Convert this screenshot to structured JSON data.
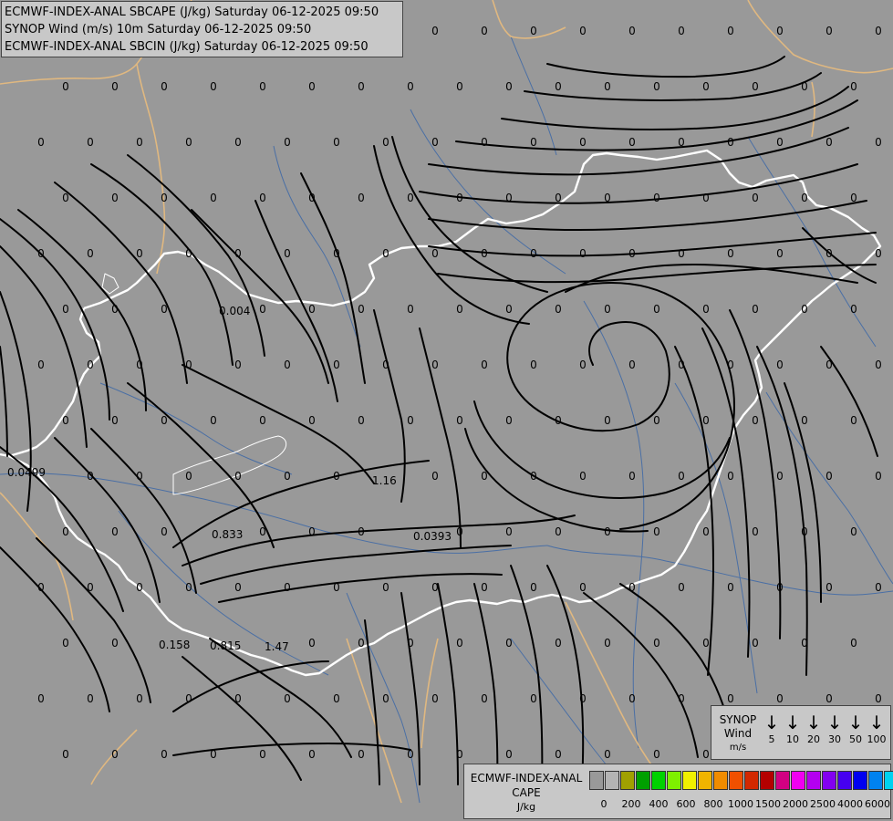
{
  "header": {
    "line1": "ECMWF-INDEX-ANAL SBCAPE (J/kg) Saturday 06-12-2025 09:50",
    "line2": "SYNOP Wind (m/s) 10m Saturday 06-12-2025 09:50",
    "line3": "ECMWF-INDEX-ANAL SBCIN (J/kg) Saturday 06-12-2025 09:50"
  },
  "map_colors": {
    "background": "#999999",
    "border_country": "#ffffff",
    "border_neighbor": "#e0b880",
    "river": "#4a6fa5",
    "streamline": "#000000",
    "value_text": "#000000"
  },
  "nonzero_values": [
    "0.004",
    "0.0499",
    "1.16",
    "0.833",
    "0.0393",
    "0.158",
    "0.815",
    "1.47"
  ],
  "wind_legend": {
    "label_line1": "SYNOP",
    "label_line2": "Wind",
    "unit": "m/s",
    "arrow_icon": "down-arrow-icon",
    "speeds": [
      "5",
      "10",
      "20",
      "30",
      "50",
      "100"
    ]
  },
  "cape_legend": {
    "label_line1": "ECMWF-INDEX-ANAL",
    "label_line2": "CAPE",
    "unit": "J/kg",
    "colors": [
      "#999999",
      "#b4b4b4",
      "#a0a000",
      "#00a000",
      "#00d200",
      "#7ef000",
      "#f0f000",
      "#f0b400",
      "#f08c00",
      "#f05000",
      "#d22800",
      "#b40000",
      "#d20082",
      "#f000f0",
      "#b400f0",
      "#8200f0",
      "#4600f0",
      "#0000f0",
      "#0082f0",
      "#00d2f0",
      "#00f0f0",
      "#ffffff"
    ],
    "ticks": [
      "0",
      "200",
      "400",
      "600",
      "800",
      "1000",
      "1500",
      "2000",
      "2500",
      "4000",
      "6000"
    ]
  }
}
